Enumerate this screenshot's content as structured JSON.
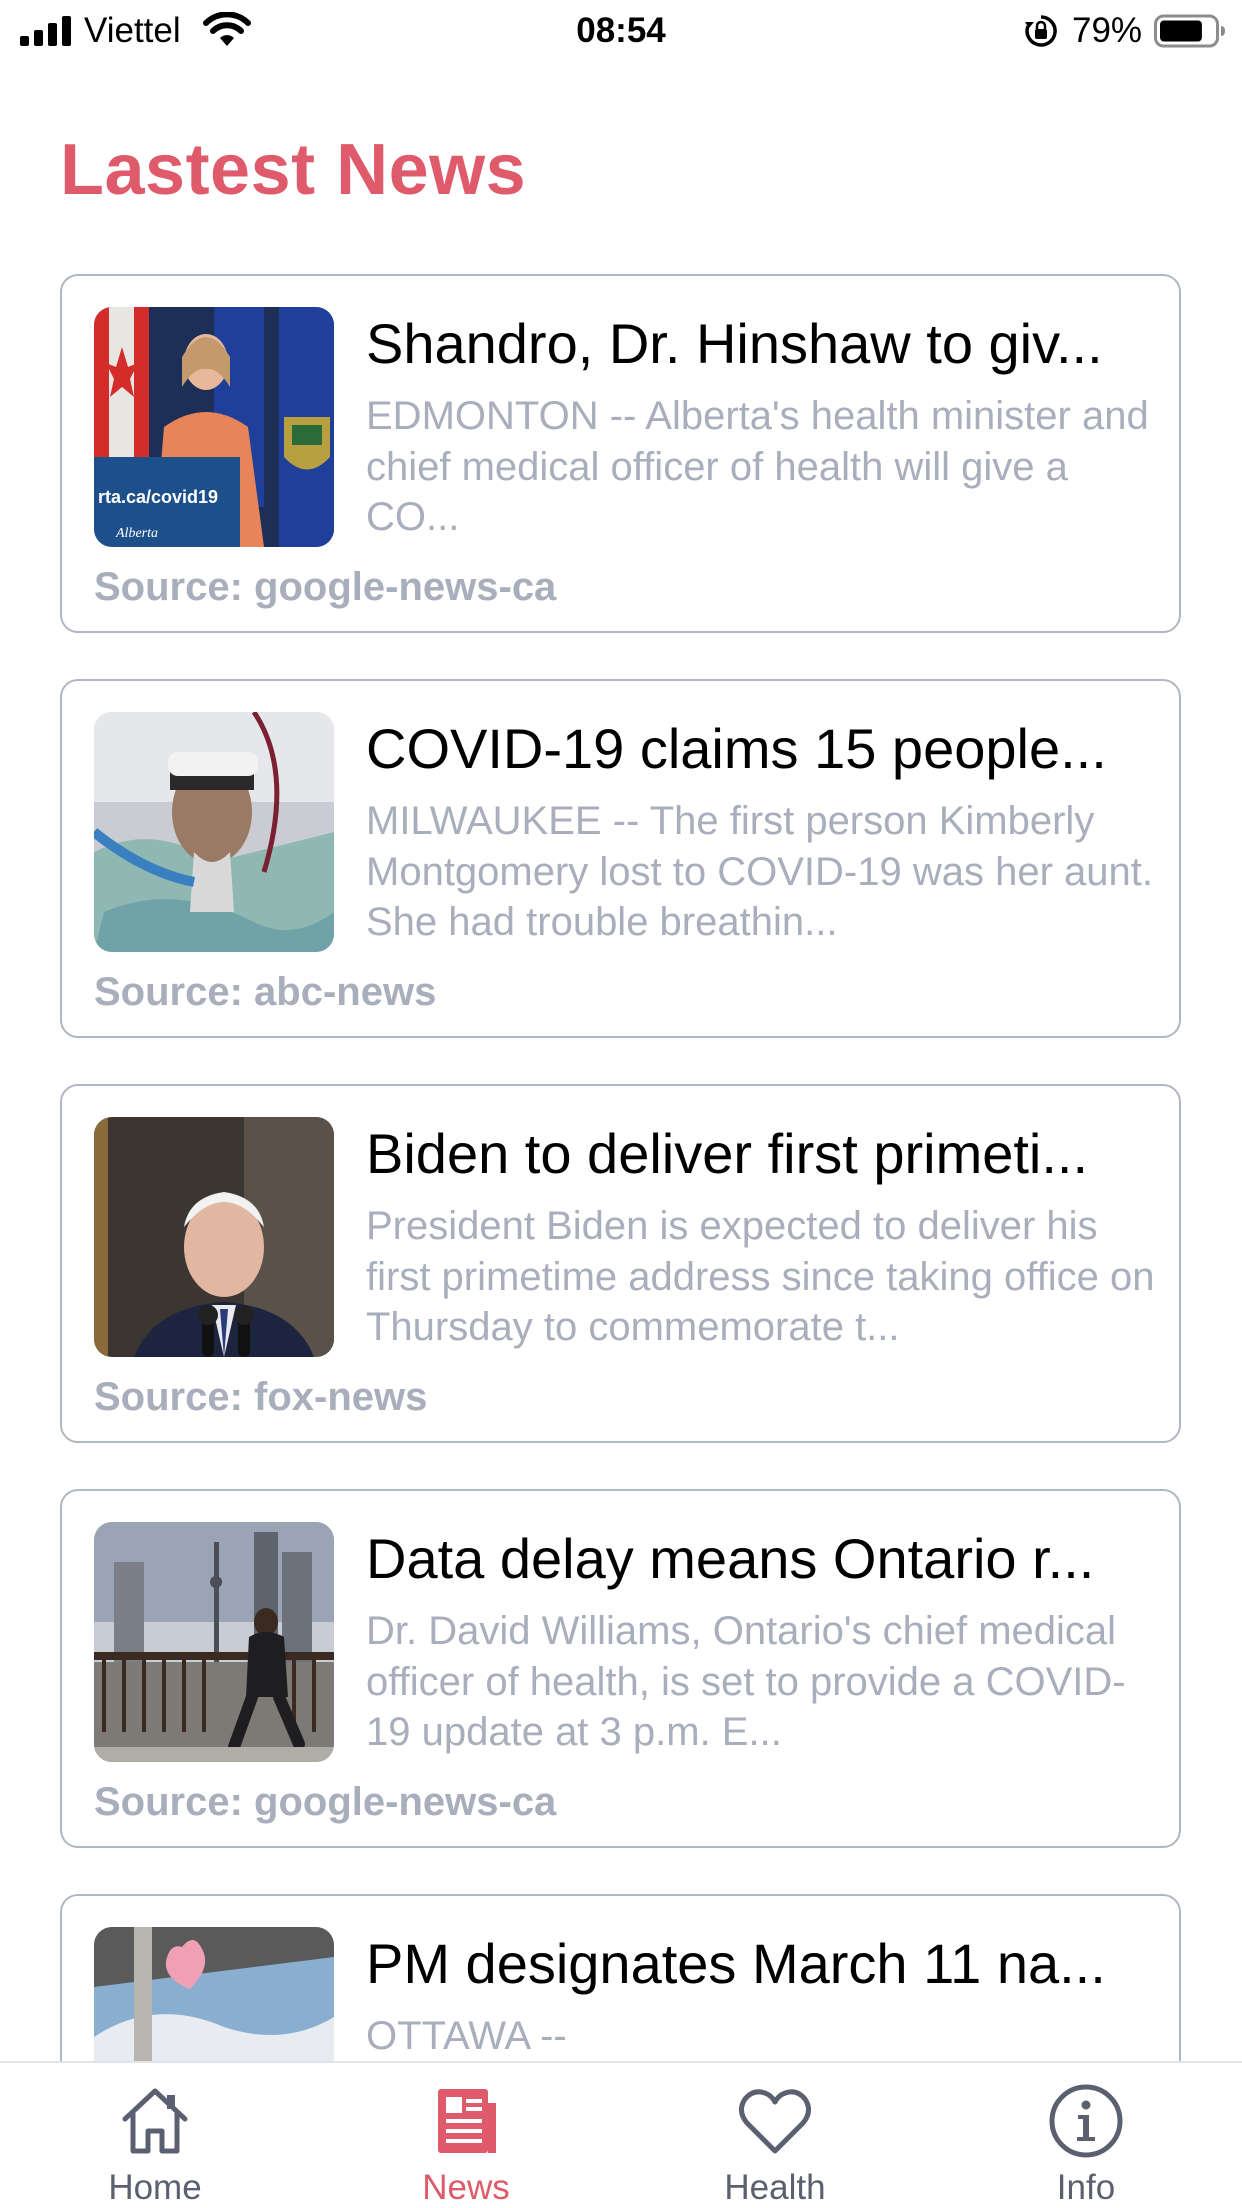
{
  "status_bar": {
    "carrier": "Viettel",
    "time": "08:54",
    "battery_percent": "79%",
    "battery_level": 0.79
  },
  "page": {
    "title": "Lastest News",
    "accent_color": "#df5a6a"
  },
  "news": [
    {
      "headline": "Shandro, Dr. Hinshaw to giv...",
      "summary": "EDMONTON -- Alberta's health minister and chief medical officer of health will give a CO...",
      "source": "Source: google-news-ca",
      "thumbnail": "health-officer-podium-photo"
    },
    {
      "headline": "COVID-19 claims 15 people...",
      "summary": "MILWAUKEE -- The first person Kimberly Montgomery lost to COVID-19 was her aunt. She had trouble breathin...",
      "source": "Source: abc-news",
      "thumbnail": "hospital-patient-photo"
    },
    {
      "headline": "Biden to deliver first primeti...",
      "summary": "President Biden is expected to deliver his first primetime address since taking office on Thursday to commemorate t...",
      "source": "Source: fox-news",
      "thumbnail": "president-portrait-photo"
    },
    {
      "headline": "Data delay means Ontario r...",
      "summary": "Dr. David Williams, Ontario's chief medical officer of health, is set to provide a COVID-19 update at 3 p.m. E...",
      "source": "Source: google-news-ca",
      "thumbnail": "toronto-street-photo"
    },
    {
      "headline": "PM designates March 11 na...",
      "summary": "OTTAWA --",
      "source": "",
      "thumbnail": "heart-window-photo"
    }
  ],
  "tab_bar": {
    "tabs": [
      {
        "label": "Home",
        "icon": "home-icon"
      },
      {
        "label": "News",
        "icon": "news-icon",
        "active": true
      },
      {
        "label": "Health",
        "icon": "heart-icon"
      },
      {
        "label": "Info",
        "icon": "info-icon"
      }
    ]
  }
}
